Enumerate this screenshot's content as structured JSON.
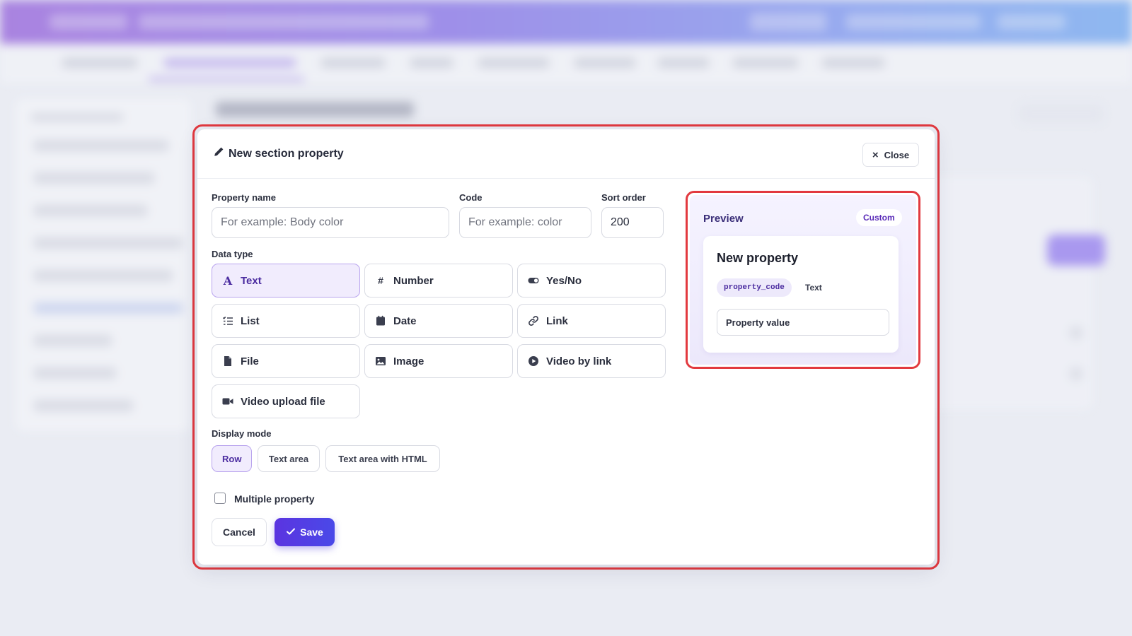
{
  "modal": {
    "title": "New section property",
    "close_label": "Close",
    "fields": {
      "property_name": {
        "label": "Property name",
        "placeholder": "For example: Body color",
        "value": ""
      },
      "code": {
        "label": "Code",
        "placeholder": "For example: color",
        "value": ""
      },
      "sort_order": {
        "label": "Sort order",
        "value": "200"
      }
    },
    "data_type": {
      "label": "Data type",
      "selected": "Text",
      "options": [
        {
          "label": "Text",
          "icon": "text-icon"
        },
        {
          "label": "Number",
          "icon": "hash-icon"
        },
        {
          "label": "Yes/No",
          "icon": "toggle-icon"
        },
        {
          "label": "List",
          "icon": "list-icon"
        },
        {
          "label": "Date",
          "icon": "calendar-icon"
        },
        {
          "label": "Link",
          "icon": "link-icon"
        },
        {
          "label": "File",
          "icon": "file-icon"
        },
        {
          "label": "Image",
          "icon": "image-icon"
        },
        {
          "label": "Video by link",
          "icon": "play-icon"
        },
        {
          "label": "Video upload file",
          "icon": "video-camera-icon"
        }
      ]
    },
    "display_mode": {
      "label": "Display mode",
      "selected": "Row",
      "options": [
        "Row",
        "Text area",
        "Text area with HTML"
      ]
    },
    "multiple_property": {
      "label": "Multiple property",
      "checked": false
    },
    "cancel_label": "Cancel",
    "save_label": "Save"
  },
  "preview": {
    "title": "Preview",
    "badge": "Custom",
    "card_title": "New property",
    "code_chip": "property_code",
    "type_chip": "Text",
    "value_placeholder": "Property value"
  },
  "colors": {
    "accent": "#5b34e0",
    "highlight_border": "#e2393f",
    "selected_bg": "#f1ecfd"
  }
}
